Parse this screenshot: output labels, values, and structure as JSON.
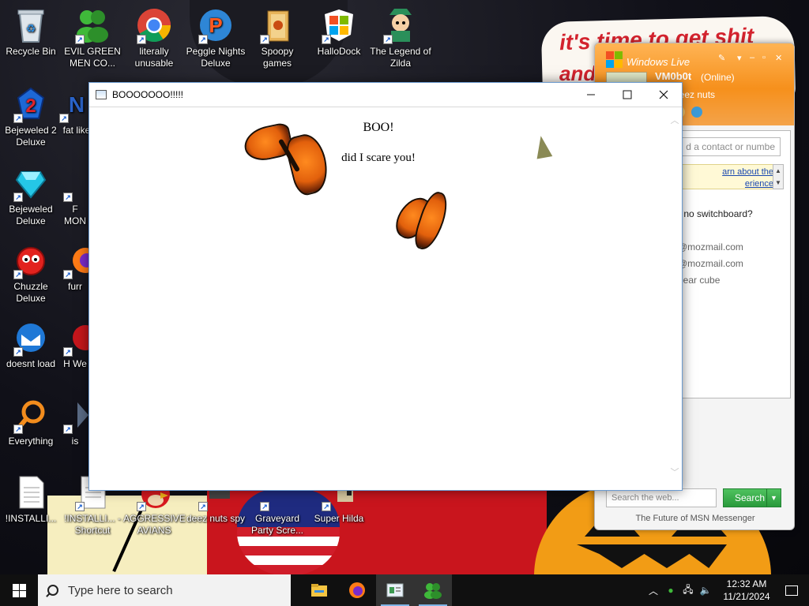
{
  "wallpaper": {
    "caption_line1": "it's time to get shit",
    "caption_line2": "and"
  },
  "desktop_icons": [
    {
      "label": "Recycle Bin",
      "icon": "recycle-bin-icon"
    },
    {
      "label": "EVIL GREEN MEN CO...",
      "icon": "green-men-icon"
    },
    {
      "label": "literally unusable",
      "icon": "chrome-icon"
    },
    {
      "label": "Peggle Nights Deluxe",
      "icon": "peggle-icon"
    },
    {
      "label": "Spoopy games",
      "icon": "folder-icon"
    },
    {
      "label": "HalloDock",
      "icon": "windows-logo-icon"
    },
    {
      "label": "The Legend of Zilda",
      "icon": "zilda-icon"
    },
    {
      "label": "Bejeweled 2 Deluxe",
      "icon": "bejeweled-2-icon"
    },
    {
      "label": "fat like",
      "icon": "fat-like-icon"
    },
    {
      "label": "Bejeweled Deluxe",
      "icon": "diamond-icon"
    },
    {
      "label": "F MON",
      "icon": "mon-icon"
    },
    {
      "label": "Chuzzle Deluxe",
      "icon": "chuzzle-icon"
    },
    {
      "label": "furr",
      "icon": "firefox-icon"
    },
    {
      "label": "doesnt load",
      "icon": "thunderbird-icon"
    },
    {
      "label": "H We",
      "icon": "red-game-icon"
    },
    {
      "label": "Everything",
      "icon": "magnifier-icon"
    },
    {
      "label": "is",
      "icon": "steam-icon"
    },
    {
      "label": "!INSTALLI...",
      "icon": "text-file-icon"
    },
    {
      "label": "!INSTALLI... - Shortcut",
      "icon": "text-file-shortcut-icon"
    },
    {
      "label": "AGGRESSIVE AVIANS",
      "icon": "angry-bird-icon"
    },
    {
      "label": "deez nuts spy",
      "icon": "spy-icon"
    },
    {
      "label": "Graveyard Party Scre...",
      "icon": "graveyard-icon"
    },
    {
      "label": "Super Hilda",
      "icon": "hilda-icon"
    }
  ],
  "window": {
    "title": "BOOOOOOO!!!!!",
    "line1": "BOO!",
    "line2": "did I scare you!"
  },
  "msn": {
    "title": "Windows Live",
    "display_name": "VM0b0t",
    "status": "(Online)",
    "personal_message": "rate deez nuts",
    "add_contact_placeholder": "d a contact or numbe",
    "banner_line1": "arn about the",
    "banner_line2": "erience",
    "contacts": [
      "- no switchboard?",
      "@mozmail.com",
      "@mozmail.com",
      "bear cube"
    ],
    "search_placeholder": "Search the web...",
    "search_button": "Search",
    "footer": "The Future of MSN Messenger"
  },
  "taskbar": {
    "search_placeholder": "Type here to search",
    "apps": [
      {
        "name": "file-explorer-icon",
        "active": false
      },
      {
        "name": "firefox-icon",
        "active": false
      },
      {
        "name": "window-app-icon",
        "active": true
      },
      {
        "name": "msn-messenger-icon",
        "active": true
      }
    ],
    "time": "12:32 AM",
    "date": "11/21/2024"
  },
  "colors": {
    "msn_orange": "#f6901c",
    "search_green": "#2a9a3c",
    "taskbar": "#101010"
  }
}
